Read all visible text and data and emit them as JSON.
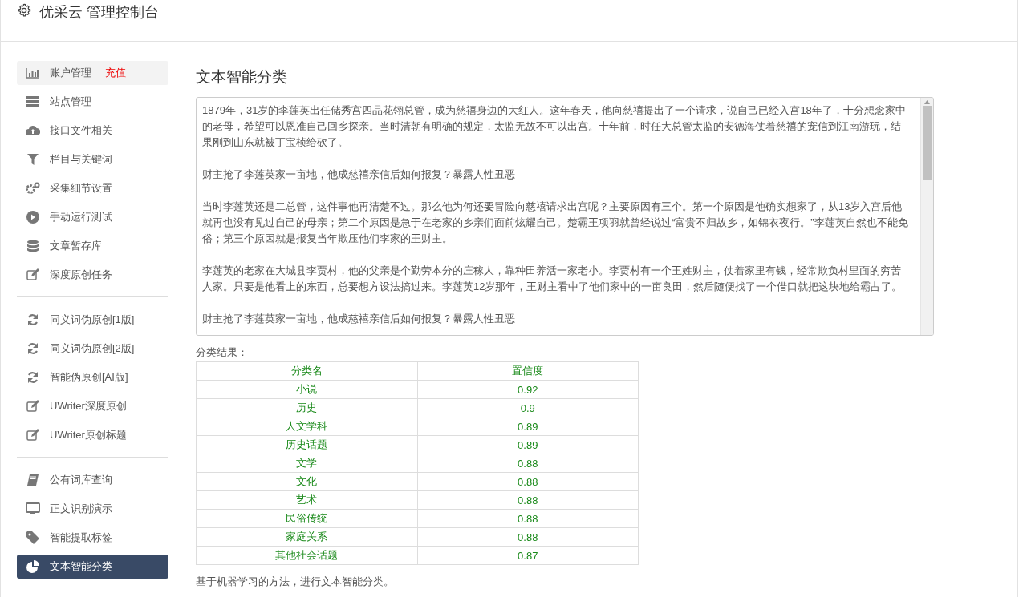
{
  "header": {
    "title": "优采云 管理控制台"
  },
  "sidebar": {
    "groups": [
      [
        {
          "label": "账户管理",
          "badge": "充值",
          "selected": false,
          "highlighted": true
        },
        {
          "label": "站点管理",
          "selected": false,
          "highlighted": false
        },
        {
          "label": "接口文件相关",
          "selected": false,
          "highlighted": false
        },
        {
          "label": "栏目与关键词",
          "selected": false,
          "highlighted": false
        },
        {
          "label": "采集细节设置",
          "selected": false,
          "highlighted": false
        },
        {
          "label": "手动运行测试",
          "selected": false,
          "highlighted": false
        },
        {
          "label": "文章暂存库",
          "selected": false,
          "highlighted": false
        },
        {
          "label": "深度原创任务",
          "selected": false,
          "highlighted": false
        }
      ],
      [
        {
          "label": "同义词伪原创[1版]",
          "selected": false,
          "highlighted": false
        },
        {
          "label": "同义词伪原创[2版]",
          "selected": false,
          "highlighted": false
        },
        {
          "label": "智能伪原创[AI版]",
          "selected": false,
          "highlighted": false
        },
        {
          "label": "UWriter深度原创",
          "selected": false,
          "highlighted": false
        },
        {
          "label": "UWriter原创标题",
          "selected": false,
          "highlighted": false
        }
      ],
      [
        {
          "label": "公有词库查询",
          "selected": false,
          "highlighted": false
        },
        {
          "label": "正文识别演示",
          "selected": false,
          "highlighted": false
        },
        {
          "label": "智能提取标签",
          "selected": false,
          "highlighted": false
        },
        {
          "label": "文本智能分类",
          "selected": true,
          "highlighted": false
        }
      ]
    ]
  },
  "main": {
    "title": "文本智能分类",
    "input_paragraphs": [
      "1879年，31岁的李莲英出任储秀宫四品花翎总管，成为慈禧身边的大红人。这年春天，他向慈禧提出了一个请求，说自己已经入宫18年了，十分想念家中的老母，希望可以恩准自己回乡探亲。当时清朝有明确的规定，太监无故不可以出宫。十年前，时任大总管太监的安德海仗着慈禧的宠信到江南游玩，结果刚到山东就被丁宝桢给砍了。",
      "财主抢了李莲英家一亩地，他成慈禧亲信后如何报复？暴露人性丑恶",
      "当时李莲英还是二总管，这件事他再清楚不过。那么他为何还要冒险向慈禧请求出宫呢？主要原因有三个。第一个原因是他确实想家了，从13岁入宫后他就再也没有见过自己的母亲；第二个原因是急于在老家的乡亲们面前炫耀自己。楚霸王项羽就曾经说过“富贵不归故乡，如锦衣夜行。”李莲英自然也不能免俗；第三个原因就是报复当年欺压他们李家的王财主。",
      "李莲英的老家在大城县李贾村，他的父亲是个勤劳本分的庄稼人，靠种田养活一家老小。李贾村有一个王姓财主，仗着家里有钱，经常欺负村里面的穷苦人家。只要是他看上的东西，总要想方设法搞过来。李莲英12岁那年，王财主看中了他们家中的一亩良田，然后随便找了一个借口就把这块地给霸占了。",
      "财主抢了李莲英家一亩地，他成慈禧亲信后如何报复？暴露人性丑恶"
    ],
    "result_label": "分类结果：",
    "table": {
      "columns": [
        "分类名",
        "置信度"
      ],
      "rows": [
        [
          "小说",
          "0.92"
        ],
        [
          "历史",
          "0.9"
        ],
        [
          "人文学科",
          "0.89"
        ],
        [
          "历史话题",
          "0.89"
        ],
        [
          "文学",
          "0.88"
        ],
        [
          "文化",
          "0.88"
        ],
        [
          "艺术",
          "0.88"
        ],
        [
          "民俗传统",
          "0.88"
        ],
        [
          "家庭关系",
          "0.88"
        ],
        [
          "其他社会话题",
          "0.87"
        ]
      ]
    },
    "footnote": "基于机器学习的方法，进行文本智能分类。"
  }
}
